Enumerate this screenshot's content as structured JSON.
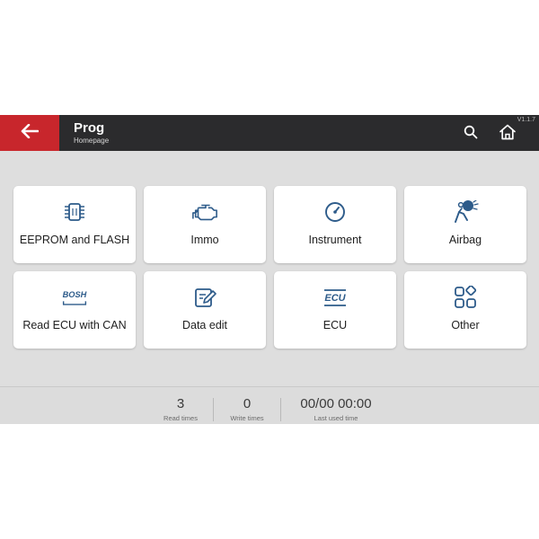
{
  "header": {
    "title": "Prog",
    "subtitle": "Homepage",
    "version": "V1.1.7",
    "back_icon": "arrow-left-icon",
    "search_icon": "search-icon",
    "home_icon": "home-icon"
  },
  "colors": {
    "brand_red": "#c8262c",
    "topbar": "#2b2b2d",
    "background": "#dedede",
    "icon_blue": "#2d5b8a"
  },
  "tiles": [
    {
      "label": "EEPROM and FLASH",
      "icon": "chip-icon"
    },
    {
      "label": "Immo",
      "icon": "engine-icon"
    },
    {
      "label": "Instrument",
      "icon": "gauge-icon"
    },
    {
      "label": "Airbag",
      "icon": "airbag-icon"
    },
    {
      "label": "Read ECU with CAN",
      "icon": "bosch-icon",
      "icon_text": "BOSH"
    },
    {
      "label": "Data edit",
      "icon": "edit-icon"
    },
    {
      "label": "ECU",
      "icon": "ecu-icon",
      "icon_text": "ECU"
    },
    {
      "label": "Other",
      "icon": "grid-icon"
    }
  ],
  "stats": {
    "read_times": {
      "value": "3",
      "label": "Read times"
    },
    "write_times": {
      "value": "0",
      "label": "Write times"
    },
    "last_used": {
      "value": "00/00 00:00",
      "label": "Last used time"
    }
  }
}
